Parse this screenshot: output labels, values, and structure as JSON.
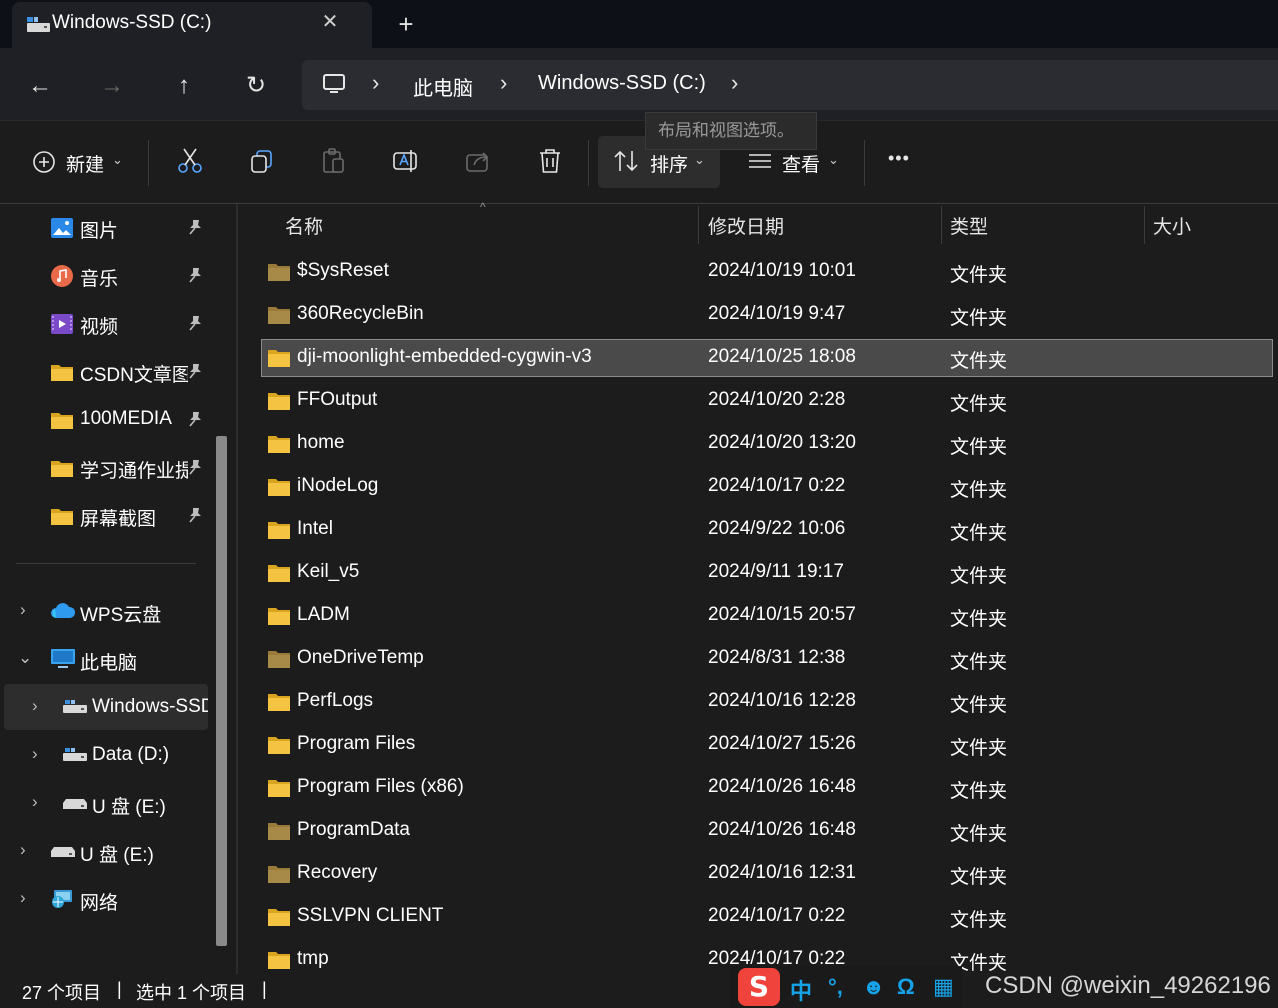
{
  "window": {
    "tab_title": "Windows-SSD (C:)",
    "close_glyph": "✕",
    "new_tab_glyph": "+"
  },
  "nav": {
    "back_glyph": "←",
    "forward_glyph": "→",
    "up_glyph": "↑",
    "refresh_glyph": "↻",
    "breadcrumb": [
      "此电脑",
      "Windows-SSD (C:)"
    ],
    "chevron": "›"
  },
  "toolbar": {
    "new_label": "新建",
    "sort_label": "排序",
    "view_label": "查看",
    "more_glyph": "•••",
    "caret": "⌄",
    "tooltip": "布局和视图选项。"
  },
  "sidebar": {
    "quick_access": [
      {
        "label": "图片",
        "icon": "pictures-icon"
      },
      {
        "label": "音乐",
        "icon": "music-icon"
      },
      {
        "label": "视频",
        "icon": "videos-icon"
      },
      {
        "label": "CSDN文章图",
        "icon": "folder-icon"
      },
      {
        "label": "100MEDIA",
        "icon": "folder-icon"
      },
      {
        "label": "学习通作业提",
        "icon": "folder-icon"
      },
      {
        "label": "屏幕截图",
        "icon": "folder-icon"
      }
    ],
    "pin_glyph": "📌",
    "tree": [
      {
        "label": "WPS云盘",
        "icon": "cloud-icon",
        "expand": "›"
      },
      {
        "label": "此电脑",
        "icon": "pc-icon",
        "expand": "⌄"
      },
      {
        "label": "Windows-SSD",
        "icon": "drive-icon",
        "expand": "›"
      },
      {
        "label": "Data (D:)",
        "icon": "drive-icon",
        "expand": "›"
      },
      {
        "label": "U 盘 (E:)",
        "icon": "usb-icon",
        "expand": "›"
      },
      {
        "label": "U 盘 (E:)",
        "icon": "usb-icon",
        "expand": "›"
      },
      {
        "label": "网络",
        "icon": "network-icon",
        "expand": "›"
      }
    ]
  },
  "columns": {
    "name": "名称",
    "modified": "修改日期",
    "type": "类型",
    "size": "大小",
    "sort_glyph": "^"
  },
  "files": [
    {
      "name": "$SysReset",
      "date": "2024/10/19 10:01",
      "type": "文件夹",
      "hidden": true
    },
    {
      "name": "360RecycleBin",
      "date": "2024/10/19 9:47",
      "type": "文件夹",
      "hidden": true
    },
    {
      "name": "dji-moonlight-embedded-cygwin-v3",
      "date": "2024/10/25 18:08",
      "type": "文件夹",
      "hidden": false,
      "selected": true
    },
    {
      "name": "FFOutput",
      "date": "2024/10/20 2:28",
      "type": "文件夹",
      "hidden": false
    },
    {
      "name": "home",
      "date": "2024/10/20 13:20",
      "type": "文件夹",
      "hidden": false
    },
    {
      "name": "iNodeLog",
      "date": "2024/10/17 0:22",
      "type": "文件夹",
      "hidden": false
    },
    {
      "name": "Intel",
      "date": "2024/9/22 10:06",
      "type": "文件夹",
      "hidden": false
    },
    {
      "name": "Keil_v5",
      "date": "2024/9/11 19:17",
      "type": "文件夹",
      "hidden": false
    },
    {
      "name": "LADM",
      "date": "2024/10/15 20:57",
      "type": "文件夹",
      "hidden": false
    },
    {
      "name": "OneDriveTemp",
      "date": "2024/8/31 12:38",
      "type": "文件夹",
      "hidden": true
    },
    {
      "name": "PerfLogs",
      "date": "2024/10/16 12:28",
      "type": "文件夹",
      "hidden": false
    },
    {
      "name": "Program Files",
      "date": "2024/10/27 15:26",
      "type": "文件夹",
      "hidden": false
    },
    {
      "name": "Program Files (x86)",
      "date": "2024/10/26 16:48",
      "type": "文件夹",
      "hidden": false
    },
    {
      "name": "ProgramData",
      "date": "2024/10/26 16:48",
      "type": "文件夹",
      "hidden": true
    },
    {
      "name": "Recovery",
      "date": "2024/10/16 12:31",
      "type": "文件夹",
      "hidden": true
    },
    {
      "name": "SSLVPN CLIENT",
      "date": "2024/10/17 0:22",
      "type": "文件夹",
      "hidden": false
    },
    {
      "name": "tmp",
      "date": "2024/10/17 0:22",
      "type": "文件夹",
      "hidden": false
    }
  ],
  "status": {
    "item_count": "27 个项目",
    "selected": "选中 1 个项目",
    "separator": "|"
  },
  "ime": {
    "logo": "S",
    "lang": "中",
    "punct": "°,",
    "emoji": "☻",
    "omega": "Ω",
    "grid": "▦"
  },
  "watermark": "CSDN @weixin_49262196",
  "colors": {
    "background": "#1c1c1c",
    "folder": "#f5c342",
    "folder_hidden": "#9a7a38",
    "selection": "#4a4a4a"
  }
}
